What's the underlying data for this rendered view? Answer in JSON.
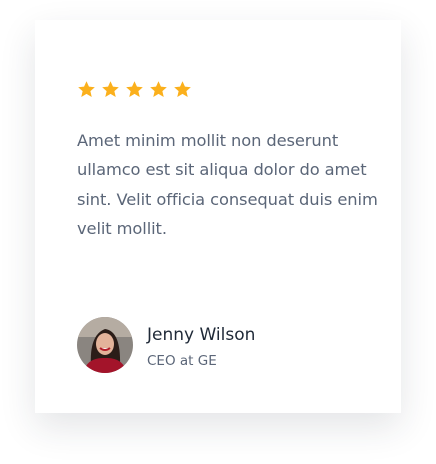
{
  "rating": {
    "value": 5,
    "max": 5,
    "color": "#fbb01c",
    "icon": "star-icon"
  },
  "testimonial": {
    "quote": "Amet minim mollit non deserunt ullamco est sit aliqua dolor do amet sint. Velit officia consequat duis enim velit mollit."
  },
  "author": {
    "name": "Jenny Wilson",
    "title": "CEO at GE"
  }
}
